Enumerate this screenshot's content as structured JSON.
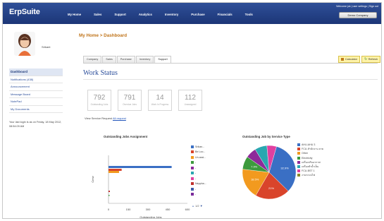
{
  "app": {
    "logo": "ErpSuite"
  },
  "nav": [
    "My Home",
    "Sales",
    "Support",
    "Analytics",
    "Inventory",
    "Purchase",
    "Financials",
    "Tools"
  ],
  "header": {
    "welcome": "Welcome jok | user settings | Sign out",
    "company": "Demo Company"
  },
  "sidebar": {
    "username": "Srikant",
    "menu": [
      "Dashboard",
      "Notifications (438)",
      "Announcement",
      "Message Board",
      "NotePad",
      "My Documents"
    ],
    "last_login": "Your last login is as on Friday, 18 May 2012, 08:54:09 AM"
  },
  "breadcrumb": "My Home > Dashboard",
  "tabs": [
    "Company",
    "Sales",
    "Purchase",
    "Inventory",
    "Support"
  ],
  "tab_actions": {
    "calculator": "Calculator",
    "refresh": "Refresh"
  },
  "work_status": {
    "title": "Work Status",
    "boxes": [
      {
        "num": "792",
        "label": "Outstanding Jobs"
      },
      {
        "num": "791",
        "label": "Overdue Jobs"
      },
      {
        "num": "14",
        "label": "Work In Progress"
      },
      {
        "num": "112",
        "label": "Unassigned"
      }
    ],
    "view_label": "View Service Request",
    "view_link": "All request"
  },
  "pager": "1/2",
  "colors": {
    "topbar": "#1f3a7a",
    "accent": "#c0741a",
    "link": "#2a4d9a"
  },
  "chart_data": [
    {
      "type": "bar",
      "title": "Outstanding Jobs Assignment",
      "xlabel": "Outstanding Jobs",
      "ylabel": "Crew",
      "xlim": [
        0,
        500
      ],
      "xticks": [
        "0",
        "150",
        "300",
        "450",
        "600"
      ],
      "series": [
        {
          "name": "Srikan...",
          "color": "#3a6fc4",
          "values": [
            480
          ]
        },
        {
          "name": "Be Loo...",
          "color": "#d9442b",
          "values": [
            100
          ]
        },
        {
          "name": "Un-assi...",
          "color": "#f29a1f",
          "values": [
            80
          ]
        },
        {
          "name": "-",
          "color": "#3d9a3d",
          "values": [
            0
          ]
        },
        {
          "name": "-",
          "color": "#8e2a9a",
          "values": [
            0
          ]
        },
        {
          "name": "-",
          "color": "#2aa7b0",
          "values": [
            0
          ]
        },
        {
          "name": "-",
          "color": "#e040a0",
          "values": [
            0
          ]
        },
        {
          "name": "Neppha...",
          "color": "#c0302e",
          "values": [
            10
          ]
        },
        {
          "name": "-",
          "color": "#3c5aa8",
          "values": [
            0
          ]
        },
        {
          "name": "-",
          "color": "#7a2a9a",
          "values": [
            0
          ]
        }
      ]
    },
    {
      "type": "pie",
      "title": "Outstanding Job by Service Type",
      "slices": [
        {
          "name": "AHU-AHU 3",
          "value": 32.9,
          "color": "#3a6fc4",
          "label": "32.9%"
        },
        {
          "name": "FCU-สำนักงาน ลาย",
          "value": 21,
          "color": "#d9442b",
          "label": "21%"
        },
        {
          "name": "Other",
          "value": 18.5,
          "color": "#f29a1f",
          "label": "18.5%"
        },
        {
          "name": "Electricity",
          "value": 7.9,
          "color": "#3d9a3d",
          "label": "7.9%"
        },
        {
          "name": "เครื่องปรับอากาศ",
          "value": 6.5,
          "color": "#8e2a9a",
          "label": ""
        },
        {
          "name": "เครื่องทำน้ำเย็น",
          "value": 7.4,
          "color": "#2aa7b0",
          "label": ""
        },
        {
          "name": "FCU-BST 1",
          "value": 5.8,
          "color": "#e040a0",
          "label": ""
        },
        {
          "name": "งานระบบไฟ",
          "value": 0,
          "color": "#8a8a2a",
          "label": ""
        }
      ]
    }
  ]
}
